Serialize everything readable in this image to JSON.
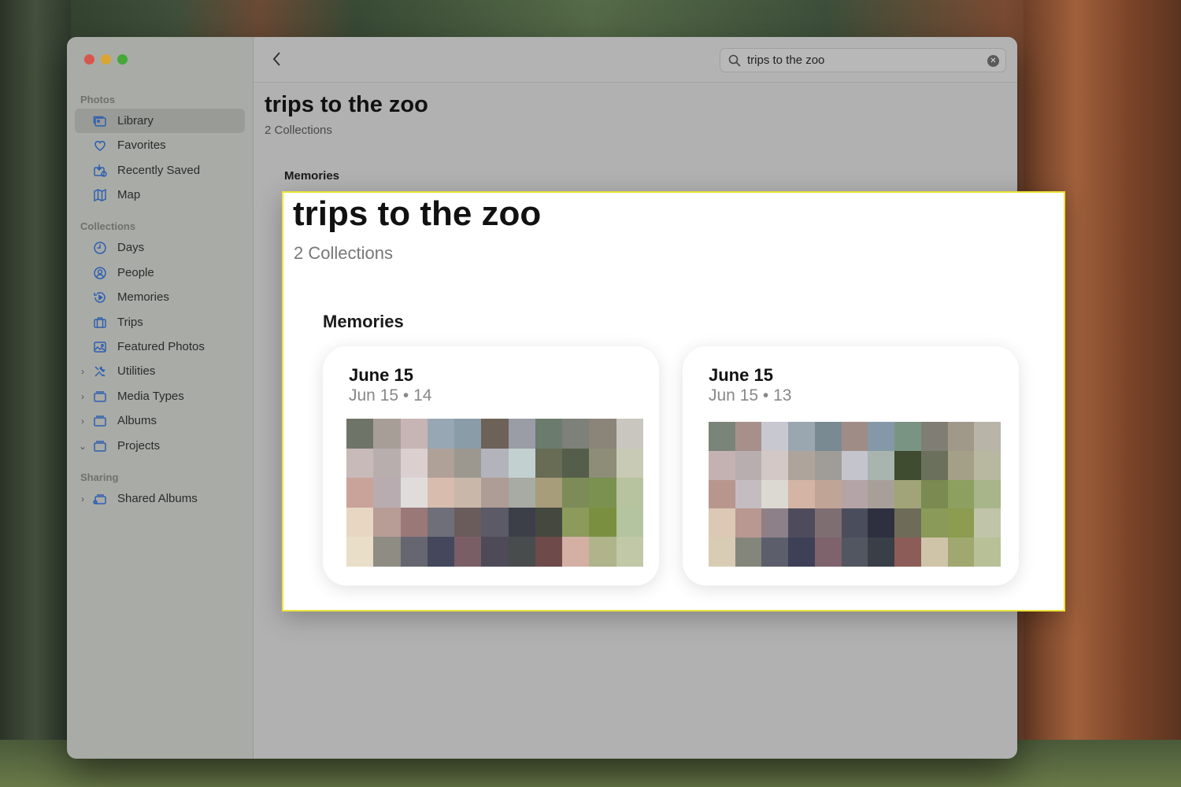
{
  "sidebar": {
    "sections": {
      "photos": "Photos",
      "collections": "Collections",
      "sharing": "Sharing"
    },
    "items": [
      {
        "label": "Library",
        "icon": "library-icon",
        "active": true
      },
      {
        "label": "Favorites",
        "icon": "heart-icon"
      },
      {
        "label": "Recently Saved",
        "icon": "recently-saved-icon"
      },
      {
        "label": "Map",
        "icon": "map-icon"
      },
      {
        "label": "Days",
        "icon": "clock-icon"
      },
      {
        "label": "People",
        "icon": "person-icon"
      },
      {
        "label": "Memories",
        "icon": "memories-icon"
      },
      {
        "label": "Trips",
        "icon": "suitcase-icon"
      },
      {
        "label": "Featured Photos",
        "icon": "photo-icon"
      },
      {
        "label": "Utilities",
        "icon": "tools-icon",
        "chevron": "right"
      },
      {
        "label": "Media Types",
        "icon": "folder-icon",
        "chevron": "right"
      },
      {
        "label": "Albums",
        "icon": "folder-icon",
        "chevron": "right"
      },
      {
        "label": "Projects",
        "icon": "folder-icon",
        "chevron": "down"
      },
      {
        "label": "Shared Albums",
        "icon": "shared-folder-icon",
        "chevron": "right"
      }
    ]
  },
  "toolbar": {
    "search_value": "trips to the zoo"
  },
  "main": {
    "title": "trips to the zoo",
    "subtitle": "2 Collections",
    "section_label": "Memories"
  },
  "zoom": {
    "title": "trips to the zoo",
    "subtitle": "2 Collections",
    "section_label": "Memories",
    "cards": [
      {
        "title": "June 15",
        "subtitle": "Jun 15 • 14"
      },
      {
        "title": "June 15",
        "subtitle": "Jun 15 • 13"
      }
    ]
  },
  "colors": {
    "accent": "#2d5fb0",
    "highlight_border": "#eee33a"
  },
  "mosaics": [
    [
      "#6f7468",
      "#a79e98",
      "#c7b4b4",
      "#98a7b4",
      "#8a9ca8",
      "#6d6257",
      "#9a9ca6",
      "#6b7c6e",
      "#7e807a",
      "#8a8578",
      "#c9c6c0",
      "#c8bab8",
      "#b9aeae",
      "#dbd0cf",
      "#b0a198",
      "#9c9890",
      "#b3b3bb",
      "#c3d0d0",
      "#686c55",
      "#545e4a",
      "#8d8d78",
      "#c9cab6",
      "#c9a39a",
      "#b9acb0",
      "#e0dcdc",
      "#d8bcae",
      "#c9b8aa",
      "#ae9c96",
      "#a8aaa4",
      "#a79d7a",
      "#7d8b58",
      "#7a9150",
      "#b7c39e",
      "#e7d7c2",
      "#b89c96",
      "#9a7878",
      "#6f6f7a",
      "#6b5c5c",
      "#5c5a66",
      "#3c3f48",
      "#45483f",
      "#8c9a5c",
      "#7a9040",
      "#b4c4a0",
      "#e9dec8",
      "#8f8c84",
      "#666670",
      "#45485c",
      "#7a5e66",
      "#4e4a58",
      "#484c4c",
      "#6e4a4a",
      "#d4b0a4",
      "#b0b48a",
      "#c0c8a8"
    ],
    [
      "#7a8478",
      "#a8908a",
      "#c8c8d0",
      "#9aa6b0",
      "#7a8a92",
      "#a08c86",
      "#8498a8",
      "#7a9484",
      "#807e74",
      "#a09888",
      "#b8b4a8",
      "#c4b2b2",
      "#b8aeb0",
      "#d4c8c6",
      "#aea49c",
      "#a09c98",
      "#c4c4cc",
      "#a8b4ae",
      "#404c30",
      "#6a705c",
      "#a4a088",
      "#b8b8a0",
      "#b8968e",
      "#c4bcc0",
      "#dcd8d2",
      "#d4b4a4",
      "#c0a496",
      "#b4a4a8",
      "#a8a098",
      "#a0a478",
      "#7a8a50",
      "#8ea060",
      "#a8b48a",
      "#dcc8b4",
      "#b89890",
      "#8e8088",
      "#4e4c5c",
      "#7e6e72",
      "#4a4e5c",
      "#2e3040",
      "#6e6c58",
      "#8a9a58",
      "#8c9c50",
      "#c0c4a8",
      "#d8ccb4",
      "#84867c",
      "#5c5e6c",
      "#3e4058",
      "#7e626c",
      "#525660",
      "#3a3e46",
      "#8c5c58",
      "#d0c4a8",
      "#a0a870",
      "#b8c098"
    ]
  ]
}
